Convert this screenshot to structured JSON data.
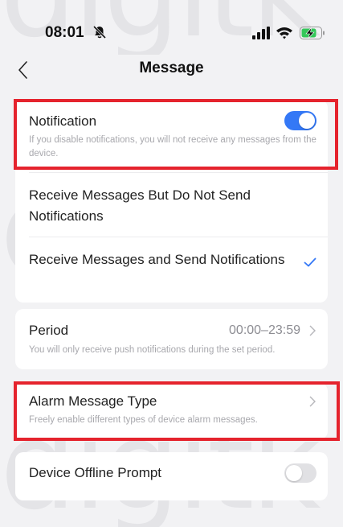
{
  "status_bar": {
    "time": "08:01"
  },
  "nav": {
    "title": "Message"
  },
  "notification": {
    "title": "Notification",
    "description": "If you disable notifications, you will not receive any messages from the device.",
    "enabled": true
  },
  "delivery_options": [
    {
      "label": "Receive Messages But Do Not Send Notifications",
      "selected": false
    },
    {
      "label": "Receive Messages and Send Notifications",
      "selected": true
    }
  ],
  "period": {
    "title": "Period",
    "value": "00:00–23:59",
    "description": "You will only receive push notifications during the set period."
  },
  "alarm": {
    "title": "Alarm Message Type",
    "description": "Freely enable different types of device alarm messages."
  },
  "offline": {
    "title": "Device Offline Prompt",
    "enabled": false
  },
  "colors": {
    "accent": "#3478f6",
    "highlight": "#e5232d",
    "toggle_off": "#e1e1e4",
    "background": "#f2f2f4"
  }
}
